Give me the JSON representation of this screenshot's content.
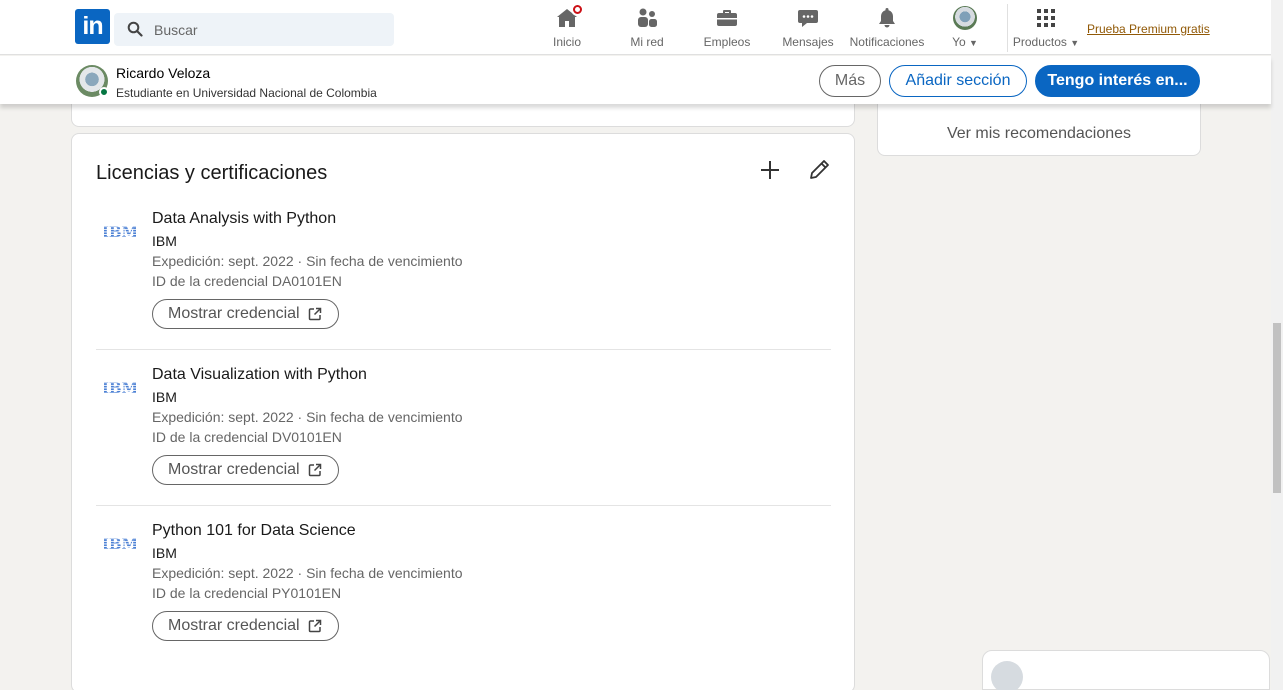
{
  "nav": {
    "search_placeholder": "Buscar",
    "items": [
      {
        "label": "Inicio",
        "icon": "home-icon"
      },
      {
        "label": "Mi red",
        "icon": "network-icon"
      },
      {
        "label": "Empleos",
        "icon": "briefcase-icon"
      },
      {
        "label": "Mensajes",
        "icon": "messaging-icon"
      },
      {
        "label": "Notificaciones",
        "icon": "bell-icon"
      },
      {
        "label": "Yo",
        "icon": "avatar"
      },
      {
        "label": "Productos",
        "icon": "grid-icon"
      }
    ],
    "premium": "Prueba Premium gratis",
    "brand_color": "#0a66c2"
  },
  "profile_bar": {
    "name": "Ricardo Veloza",
    "headline": "Estudiante en Universidad Nacional de Colombia",
    "more_button": "Más",
    "add_section_button": "Añadir sección",
    "interest_button": "Tengo interés en..."
  },
  "sidebar": {
    "recommendations_link": "Ver mis recomendaciones"
  },
  "licenses": {
    "title": "Licencias y certificaciones",
    "items": [
      {
        "name": "Data Analysis with Python",
        "issuer": "IBM",
        "date": "Expedición: sept. 2022 · Sin fecha de vencimiento",
        "credential_id": "ID de la credencial DA0101EN",
        "button": "Mostrar credencial",
        "logo": "IBM"
      },
      {
        "name": "Data Visualization with Python",
        "issuer": "IBM",
        "date": "Expedición: sept. 2022 · Sin fecha de vencimiento",
        "credential_id": "ID de la credencial DV0101EN",
        "button": "Mostrar credencial",
        "logo": "IBM"
      },
      {
        "name": "Python 101 for Data Science",
        "issuer": "IBM",
        "date": "Expedición: sept. 2022 · Sin fecha de vencimiento",
        "credential_id": "ID de la credencial PY0101EN",
        "button": "Mostrar credencial",
        "logo": "IBM"
      }
    ]
  }
}
